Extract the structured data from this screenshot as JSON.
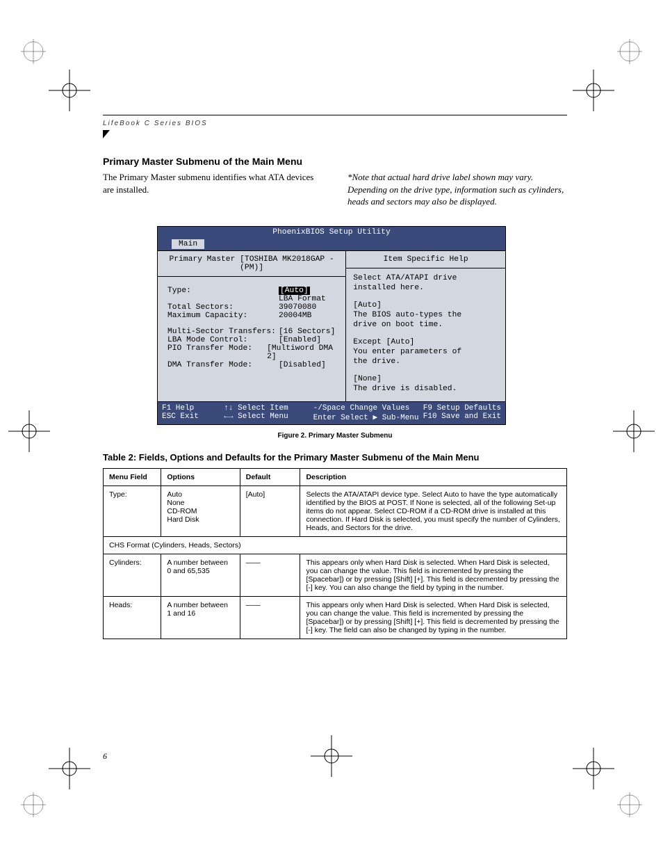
{
  "running_head": "LifeBook C Series BIOS",
  "section_title": "Primary Master Submenu of the Main Menu",
  "intro_left": "The Primary Master submenu identifies what ATA devices are installed.",
  "intro_right": "*Note that actual hard drive label shown may vary. Depending on the drive type, information such as cylinders, heads and sectors may also be displayed.",
  "bios": {
    "title": "PhoenixBIOS Setup Utility",
    "tab": "Main",
    "left_header": "Primary Master [TOSHIBA MK2018GAP -(PM)]",
    "right_header": "Item Specific Help",
    "fields": {
      "type_label": "Type:",
      "type_value": "[Auto]",
      "lba_format": "LBA Format",
      "total_sectors_label": "Total Sectors:",
      "total_sectors_value": "39070080",
      "max_cap_label": "Maximum Capacity:",
      "max_cap_value": "20004MB",
      "multi_label": "Multi-Sector Transfers:",
      "multi_value": "[16 Sectors]",
      "lba_ctl_label": "LBA Mode Control:",
      "lba_ctl_value": "[Enabled]",
      "pio_label": "PIO Transfer Mode:",
      "pio_value": "[Multiword DMA 2]",
      "dma_label": "DMA Transfer Mode:",
      "dma_value": "[Disabled]"
    },
    "help": {
      "l1": "Select ATA/ATAPI drive",
      "l2": "installed here.",
      "l3": "[Auto]",
      "l4": "The BIOS auto-types the",
      "l5": "drive on boot time.",
      "l6": "Except [Auto]",
      "l7": "You enter parameters of",
      "l8": "the drive.",
      "l9": "[None]",
      "l10": "The drive is disabled."
    },
    "footer": {
      "r1c1": "F1  Help",
      "r1c2": "↑↓ Select Item",
      "r1c3": "-/Space  Change Values",
      "r1c4": "F9   Setup Defaults",
      "r2c1": "ESC Exit",
      "r2c2": "←→ Select Menu",
      "r2c3": "Enter  Select ▶ Sub-Menu",
      "r2c4": "F10  Save and Exit"
    }
  },
  "figure_caption": "Figure 2.  Primary Master Submenu",
  "table_title": "Table 2: Fields, Options and Defaults for the Primary Master Submenu of the Main Menu",
  "table": {
    "headers": {
      "c1": "Menu Field",
      "c2": "Options",
      "c3": "Default",
      "c4": "Description"
    },
    "rows": [
      {
        "field": "Type:",
        "options": "Auto\nNone\nCD-ROM\nHard Disk",
        "default": "[Auto]",
        "desc": "Selects the ATA/ATAPI device type. Select Auto to have the type automatically identified by the BIOS at POST. If None is selected, all of the following Set-up items do not appear. Select CD-ROM if a CD-ROM drive is installed at this connection. If Hard Disk is selected, you must specify the number of Cylinders, Heads, and Sectors for the drive."
      },
      {
        "span": "CHS Format (Cylinders, Heads, Sectors)"
      },
      {
        "field": "Cylinders:",
        "options": "A number between\n0 and 65,535",
        "default": "——",
        "desc": "This appears only when Hard Disk is selected. When Hard Disk is selected, you can change the value. This field is incremented by pressing the [Spacebar]) or by pressing [Shift] [+]. This field is decremented by pressing the [-] key. You can also change the field by typing in the number."
      },
      {
        "field": "Heads:",
        "options": "A number between\n1 and 16",
        "default": "——",
        "desc": "This appears only when Hard Disk is selected. When Hard Disk is selected, you can change the value. This field is incremented by pressing the [Spacebar]) or by pressing [Shift] [+]. This field is decremented by pressing the [-] key. The field can also be changed by typing in the number."
      }
    ]
  },
  "page_number": "6"
}
